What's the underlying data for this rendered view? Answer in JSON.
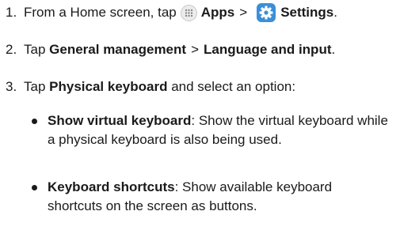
{
  "steps": [
    {
      "num": "1.",
      "prefix": "From a Home screen, tap",
      "apps_label": "Apps",
      "separator": ">",
      "settings_label": "Settings",
      "suffix": "."
    },
    {
      "num": "2.",
      "prefix": "Tap",
      "item1": "General management",
      "separator": ">",
      "item2": "Language and input",
      "suffix": "."
    },
    {
      "num": "3.",
      "prefix": "Tap",
      "item": "Physical keyboard",
      "suffix": "and select an option:"
    }
  ],
  "options": [
    {
      "title": "Show virtual keyboard",
      "description": ": Show the virtual keyboard while a physical keyboard is also being used."
    },
    {
      "title": "Keyboard shortcuts",
      "description": ": Show available keyboard shortcuts on the screen as buttons."
    }
  ],
  "icons": {
    "apps": "apps-grid-icon",
    "settings": "settings-gear-icon"
  },
  "colors": {
    "text": "#1a1a1a",
    "settings_icon_bg": "#3b8fd8"
  }
}
